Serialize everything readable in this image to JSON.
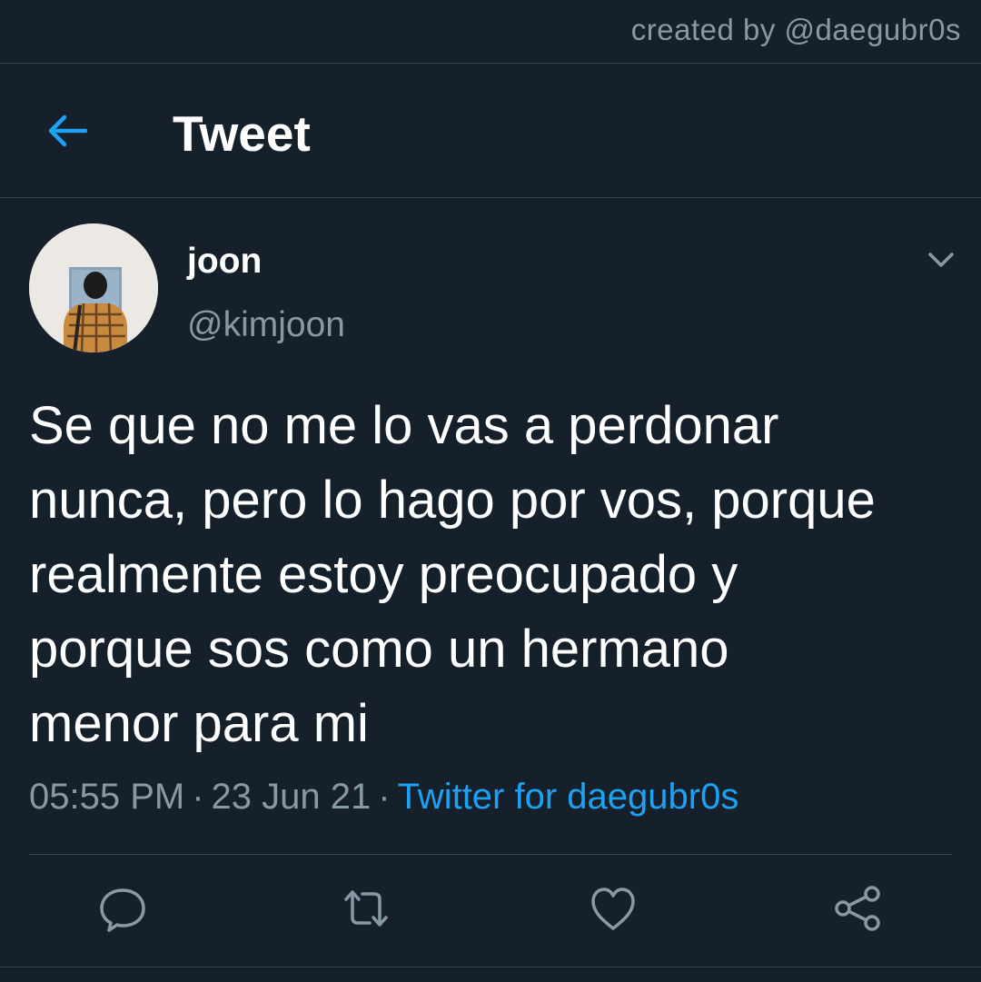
{
  "watermark": "created by @daegubr0s",
  "header": {
    "back_icon": "arrow-left-icon",
    "title": "Tweet"
  },
  "tweet": {
    "author": {
      "name": "joon",
      "handle": "@kimjoon",
      "avatar_icon": "avatar"
    },
    "text_lines": [
      "Se que no me lo vas a perdonar",
      "nunca, pero lo hago por vos, porque",
      "realmente estoy preocupado y",
      "porque sos como un hermano",
      "menor para mi"
    ],
    "time": "05:55 PM",
    "date": "23 Jun 21",
    "separator": "·",
    "source": "Twitter for daegubr0s"
  },
  "actions": [
    {
      "name": "reply",
      "icon": "comment-icon"
    },
    {
      "name": "retweet",
      "icon": "retweet-icon"
    },
    {
      "name": "like",
      "icon": "heart-icon"
    },
    {
      "name": "share",
      "icon": "share-icon"
    }
  ],
  "colors": {
    "background": "#15202b",
    "divider": "#38444d",
    "secondary_text": "#8899a6",
    "accent": "#1da1f2",
    "primary_text": "#ffffff"
  }
}
